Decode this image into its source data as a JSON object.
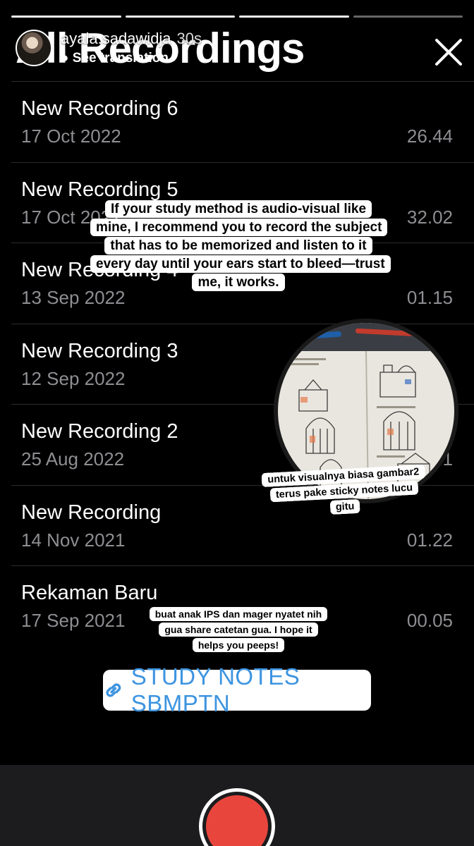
{
  "story": {
    "username": "ayala.sadawidja",
    "time_ago": "30s",
    "see_translation": "See translation"
  },
  "app": {
    "title": "All Recordings"
  },
  "recordings": [
    {
      "name": "New Recording 6",
      "date": "17 Oct 2022",
      "duration": "26.44"
    },
    {
      "name": "New Recording 5",
      "date": "17 Oct 2022",
      "duration": "32.02"
    },
    {
      "name": "New Recording 4",
      "date": "13 Sep 2022",
      "duration": "01.15"
    },
    {
      "name": "New Recording 3",
      "date": "12 Sep 2022",
      "duration": ""
    },
    {
      "name": "New Recording 2",
      "date": "25 Aug 2022",
      "duration": "1"
    },
    {
      "name": "New Recording",
      "date": "14 Nov 2021",
      "duration": "01.22"
    },
    {
      "name": "Rekaman Baru",
      "date": "17 Sep 2021",
      "duration": "00.05"
    }
  ],
  "stickers": {
    "caption_main": "If your study method is audio-visual like mine, I recommend you to record the subject that has to be memorized and listen to it every day until your ears start to bleed—trust me, it works.",
    "caption_visual": "untuk visualnya biasa gambar2 terus pake sticky notes lucu gitu",
    "caption_share": "buat anak IPS dan mager nyatet nih gua share catetan gua. I hope it helps you peeps!",
    "link_label": "STUDY NOTES SBMPTN"
  },
  "colors": {
    "record_red": "#e8463d",
    "link_blue": "#3d94e0",
    "secondary_text": "#8e8e93"
  },
  "icons": {
    "close": "close-icon",
    "link": "link-icon",
    "chevron": "chevron-right-icon"
  }
}
